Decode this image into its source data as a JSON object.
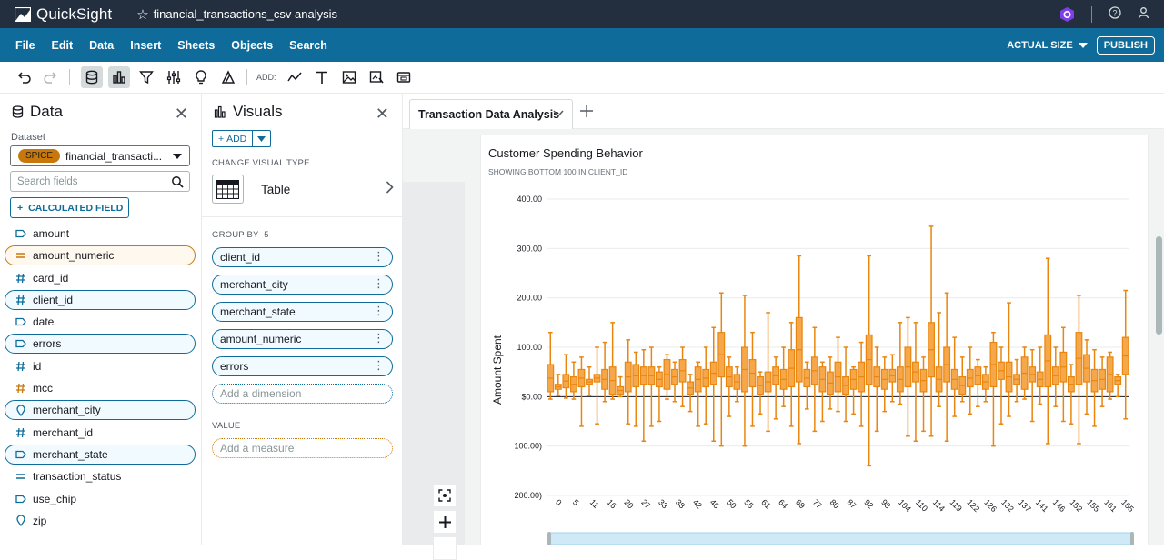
{
  "app": {
    "name": "QuickSight",
    "analysis_name": "financial_transactions_csv analysis"
  },
  "menu": [
    "File",
    "Edit",
    "Data",
    "Insert",
    "Sheets",
    "Objects",
    "Search"
  ],
  "menu_right": {
    "actual_size": "ACTUAL SIZE",
    "publish": "PUBLISH"
  },
  "toolbar": {
    "add_label": "ADD:"
  },
  "data_panel": {
    "title": "Data",
    "dataset_label": "Dataset",
    "spice_badge": "SPICE",
    "dataset_name": "financial_transacti...",
    "search_placeholder": "Search fields",
    "calculated_field": "CALCULATED FIELD",
    "fields": [
      {
        "name": "amount",
        "icon": "tag-icon",
        "selected": ""
      },
      {
        "name": "amount_numeric",
        "icon": "measure-icon",
        "selected": "orange"
      },
      {
        "name": "card_id",
        "icon": "hash-icon",
        "selected": ""
      },
      {
        "name": "client_id",
        "icon": "hash-icon",
        "selected": "blue"
      },
      {
        "name": "date",
        "icon": "tag-icon",
        "selected": ""
      },
      {
        "name": "errors",
        "icon": "tag-icon",
        "selected": "blue"
      },
      {
        "name": "id",
        "icon": "hash-icon",
        "selected": ""
      },
      {
        "name": "mcc",
        "icon": "hash-orange-icon",
        "selected": ""
      },
      {
        "name": "merchant_city",
        "icon": "location-icon",
        "selected": "blue"
      },
      {
        "name": "merchant_id",
        "icon": "hash-icon",
        "selected": ""
      },
      {
        "name": "merchant_state",
        "icon": "tag-icon",
        "selected": "blue"
      },
      {
        "name": "transaction_status",
        "icon": "measure-blue-icon",
        "selected": ""
      },
      {
        "name": "use_chip",
        "icon": "tag-icon",
        "selected": ""
      },
      {
        "name": "zip",
        "icon": "location-icon",
        "selected": ""
      }
    ]
  },
  "visuals_panel": {
    "title": "Visuals",
    "add": "ADD",
    "change_visual_type": "CHANGE VISUAL TYPE",
    "visual_type": "Table",
    "group_by_label": "GROUP BY",
    "group_by_count": "5",
    "group_by": [
      "client_id",
      "merchant_city",
      "merchant_state",
      "amount_numeric",
      "errors"
    ],
    "add_dimension": "Add a dimension",
    "value_label": "VALUE",
    "add_measure": "Add a measure"
  },
  "sheet": {
    "tab_name": "Transaction Data Analysis"
  },
  "visual": {
    "title": "Customer Spending Behavior",
    "subtitle": "SHOWING BOTTOM 100 IN CLIENT_ID"
  },
  "colors": {
    "topbar": "#232f3e",
    "menubar": "#0f6c9a",
    "box_fill": "#f6a74a",
    "box_stroke": "#e8860f",
    "field_orange": "#c8780a"
  },
  "chart_data": {
    "type": "boxplot",
    "ylabel": "Amount Spent",
    "ylim": [
      -200,
      400
    ],
    "y_ticks": [
      -200,
      -100,
      0,
      100,
      200,
      300,
      400
    ],
    "y_tick_labels": [
      "200.00)",
      "100.00)",
      "$0.00",
      "100.00",
      "200.00",
      "300.00",
      "400.00"
    ],
    "x_tick_labels": [
      "0",
      "5",
      "11",
      "16",
      "20",
      "27",
      "33",
      "38",
      "42",
      "46",
      "50",
      "55",
      "61",
      "64",
      "69",
      "77",
      "80",
      "87",
      "92",
      "98",
      "104",
      "110",
      "114",
      "119",
      "122",
      "126",
      "132",
      "137",
      "141",
      "146",
      "152",
      "155",
      "161",
      "165"
    ],
    "boxes": [
      {
        "min": -5,
        "q1": 10,
        "q3": 65,
        "max": 130
      },
      {
        "min": 2,
        "q1": 15,
        "q3": 25,
        "max": 45
      },
      {
        "min": -3,
        "q1": 18,
        "q3": 45,
        "max": 85
      },
      {
        "min": -5,
        "q1": 10,
        "q3": 40,
        "max": 70
      },
      {
        "min": -60,
        "q1": 20,
        "q3": 55,
        "max": 80
      },
      {
        "min": 2,
        "q1": 25,
        "q3": 35,
        "max": 60
      },
      {
        "min": -55,
        "q1": 30,
        "q3": 45,
        "max": 100
      },
      {
        "min": -10,
        "q1": 15,
        "q3": 55,
        "max": 110
      },
      {
        "min": -5,
        "q1": 5,
        "q3": 60,
        "max": 150
      },
      {
        "min": 0,
        "q1": 5,
        "q3": 20,
        "max": 40
      },
      {
        "min": -55,
        "q1": 10,
        "q3": 70,
        "max": 115
      },
      {
        "min": -60,
        "q1": 20,
        "q3": 65,
        "max": 90
      },
      {
        "min": -90,
        "q1": 25,
        "q3": 60,
        "max": 95
      },
      {
        "min": -60,
        "q1": 25,
        "q3": 60,
        "max": 100
      },
      {
        "min": -50,
        "q1": 20,
        "q3": 50,
        "max": 60
      },
      {
        "min": -5,
        "q1": 15,
        "q3": 75,
        "max": 85
      },
      {
        "min": -10,
        "q1": 25,
        "q3": 55,
        "max": 70
      },
      {
        "min": -20,
        "q1": 30,
        "q3": 75,
        "max": 100
      },
      {
        "min": -30,
        "q1": 5,
        "q3": 30,
        "max": 45
      },
      {
        "min": -60,
        "q1": 10,
        "q3": 60,
        "max": 70
      },
      {
        "min": -55,
        "q1": 20,
        "q3": 55,
        "max": 100
      },
      {
        "min": -90,
        "q1": 25,
        "q3": 70,
        "max": 140
      },
      {
        "min": -100,
        "q1": 40,
        "q3": 130,
        "max": 210
      },
      {
        "min": -40,
        "q1": 20,
        "q3": 60,
        "max": 80
      },
      {
        "min": -10,
        "q1": 15,
        "q3": 45,
        "max": 60
      },
      {
        "min": -100,
        "q1": 10,
        "q3": 100,
        "max": 205
      },
      {
        "min": -60,
        "q1": 20,
        "q3": 75,
        "max": 130
      },
      {
        "min": -35,
        "q1": 5,
        "q3": 40,
        "max": 50
      },
      {
        "min": -70,
        "q1": 10,
        "q3": 50,
        "max": 170
      },
      {
        "min": -45,
        "q1": 25,
        "q3": 60,
        "max": 80
      },
      {
        "min": -20,
        "q1": 15,
        "q3": 55,
        "max": 100
      },
      {
        "min": -60,
        "q1": 20,
        "q3": 95,
        "max": 150
      },
      {
        "min": -95,
        "q1": 30,
        "q3": 160,
        "max": 285
      },
      {
        "min": -25,
        "q1": 20,
        "q3": 55,
        "max": 70
      },
      {
        "min": -70,
        "q1": 25,
        "q3": 80,
        "max": 140
      },
      {
        "min": -50,
        "q1": 10,
        "q3": 60,
        "max": 70
      },
      {
        "min": -25,
        "q1": 5,
        "q3": 50,
        "max": 80
      },
      {
        "min": -30,
        "q1": 10,
        "q3": 70,
        "max": 120
      },
      {
        "min": -50,
        "q1": 5,
        "q3": 40,
        "max": 100
      },
      {
        "min": -35,
        "q1": 15,
        "q3": 55,
        "max": 60
      },
      {
        "min": -60,
        "q1": 10,
        "q3": 70,
        "max": 110
      },
      {
        "min": -140,
        "q1": 25,
        "q3": 125,
        "max": 285
      },
      {
        "min": -70,
        "q1": 20,
        "q3": 60,
        "max": 100
      },
      {
        "min": -30,
        "q1": 15,
        "q3": 55,
        "max": 80
      },
      {
        "min": -10,
        "q1": 30,
        "q3": 55,
        "max": 85
      },
      {
        "min": -15,
        "q1": 10,
        "q3": 60,
        "max": 150
      },
      {
        "min": -80,
        "q1": 20,
        "q3": 100,
        "max": 160
      },
      {
        "min": -90,
        "q1": 30,
        "q3": 70,
        "max": 150
      },
      {
        "min": -70,
        "q1": 10,
        "q3": 55,
        "max": 80
      },
      {
        "min": -80,
        "q1": 40,
        "q3": 150,
        "max": 345
      },
      {
        "min": -20,
        "q1": 10,
        "q3": 60,
        "max": 170
      },
      {
        "min": -90,
        "q1": 30,
        "q3": 100,
        "max": 210
      },
      {
        "min": -40,
        "q1": 15,
        "q3": 55,
        "max": 120
      },
      {
        "min": -10,
        "q1": 5,
        "q3": 40,
        "max": 80
      },
      {
        "min": -35,
        "q1": 20,
        "q3": 55,
        "max": 100
      },
      {
        "min": -20,
        "q1": 25,
        "q3": 60,
        "max": 75
      },
      {
        "min": -10,
        "q1": 15,
        "q3": 45,
        "max": 60
      },
      {
        "min": -100,
        "q1": 20,
        "q3": 110,
        "max": 130
      },
      {
        "min": -55,
        "q1": 35,
        "q3": 70,
        "max": 100
      },
      {
        "min": -40,
        "q1": 10,
        "q3": 70,
        "max": 190
      },
      {
        "min": -10,
        "q1": 25,
        "q3": 45,
        "max": 75
      },
      {
        "min": -5,
        "q1": 15,
        "q3": 80,
        "max": 100
      },
      {
        "min": -50,
        "q1": 30,
        "q3": 60,
        "max": 95
      },
      {
        "min": -15,
        "q1": 20,
        "q3": 50,
        "max": 100
      },
      {
        "min": -95,
        "q1": 20,
        "q3": 125,
        "max": 280
      },
      {
        "min": -20,
        "q1": 25,
        "q3": 60,
        "max": 100
      },
      {
        "min": -50,
        "q1": 30,
        "q3": 90,
        "max": 140
      },
      {
        "min": -55,
        "q1": 10,
        "q3": 40,
        "max": 65
      },
      {
        "min": -95,
        "q1": 25,
        "q3": 130,
        "max": 205
      },
      {
        "min": -35,
        "q1": 30,
        "q3": 85,
        "max": 115
      },
      {
        "min": -60,
        "q1": 10,
        "q3": 55,
        "max": 95
      },
      {
        "min": -20,
        "q1": 15,
        "q3": 55,
        "max": 80
      },
      {
        "min": -5,
        "q1": 10,
        "q3": 80,
        "max": 90
      },
      {
        "min": 0,
        "q1": 25,
        "q3": 40,
        "max": 45
      },
      {
        "min": -45,
        "q1": 45,
        "q3": 120,
        "max": 215
      }
    ]
  }
}
